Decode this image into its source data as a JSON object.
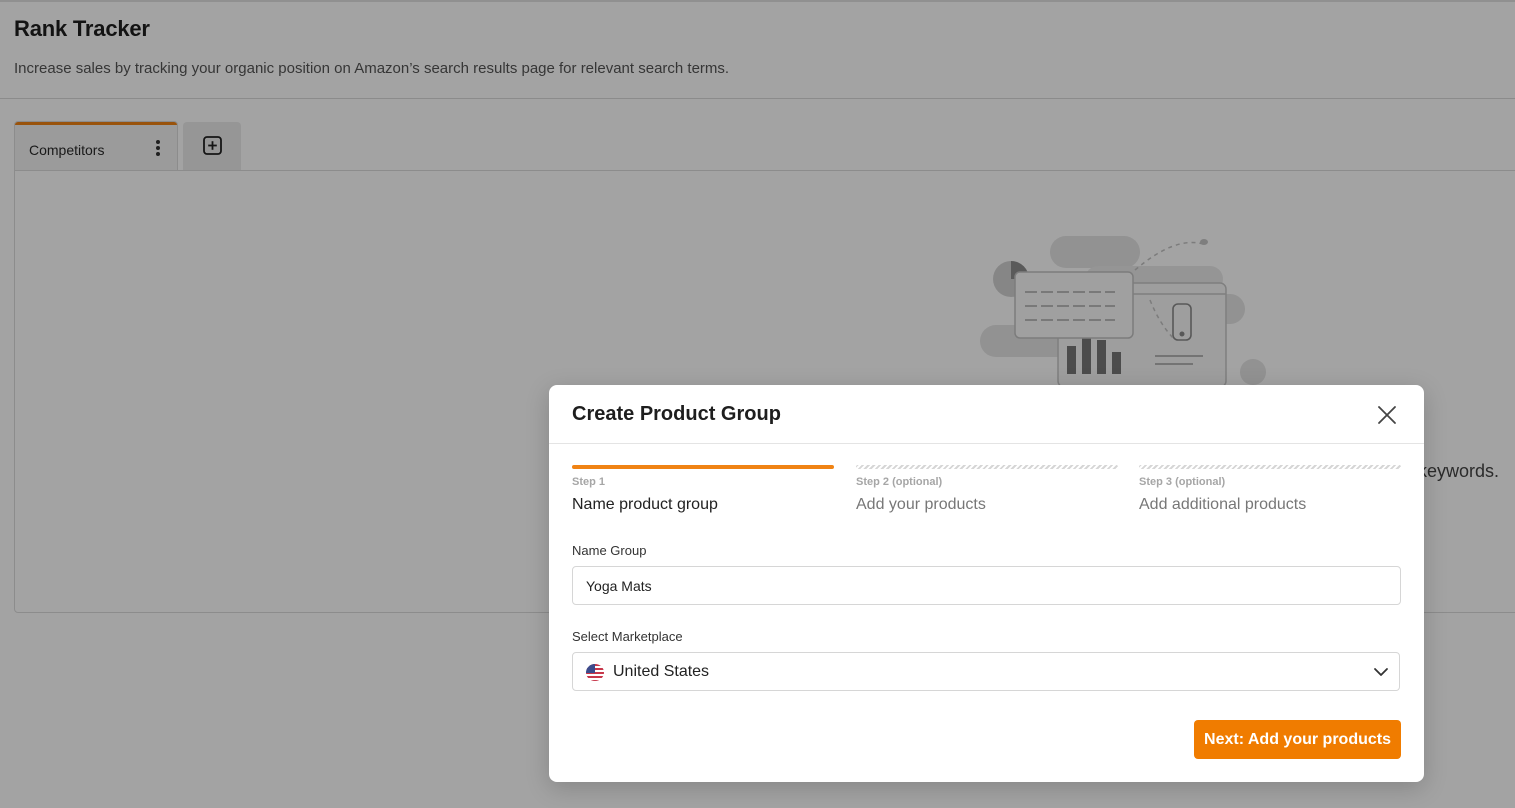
{
  "header": {
    "title": "Rank Tracker",
    "subtitle": "Increase sales by tracking your organic position on Amazon’s search results page for relevant search terms."
  },
  "tabs": [
    {
      "label": "Competitors",
      "active": true
    }
  ],
  "icons": {
    "tab_menu": "vertical-dots-icon",
    "add_tab": "plus-square-icon",
    "empty_state": "dashboard-illustration",
    "close": "close-icon",
    "dropdown": "chevron-down-icon",
    "flag": "us-flag-icon"
  },
  "empty_state": {
    "text_fragment": "keywords."
  },
  "modal": {
    "title": "Create Product Group",
    "steps": [
      {
        "kicker": "Step 1",
        "name": "Name product group",
        "status": "active"
      },
      {
        "kicker": "Step 2 (optional)",
        "name": "Add your products",
        "status": "pending"
      },
      {
        "kicker": "Step 3 (optional)",
        "name": "Add additional products",
        "status": "pending"
      }
    ],
    "name_group": {
      "label": "Name Group",
      "value": "Yoga Mats"
    },
    "marketplace": {
      "label": "Select Marketplace",
      "value": "United States"
    },
    "next_button": "Next: Add your products"
  },
  "colors": {
    "accent": "#f08314",
    "button": "#f07c00",
    "overlay": "rgba(0,0,0,0.36)"
  }
}
